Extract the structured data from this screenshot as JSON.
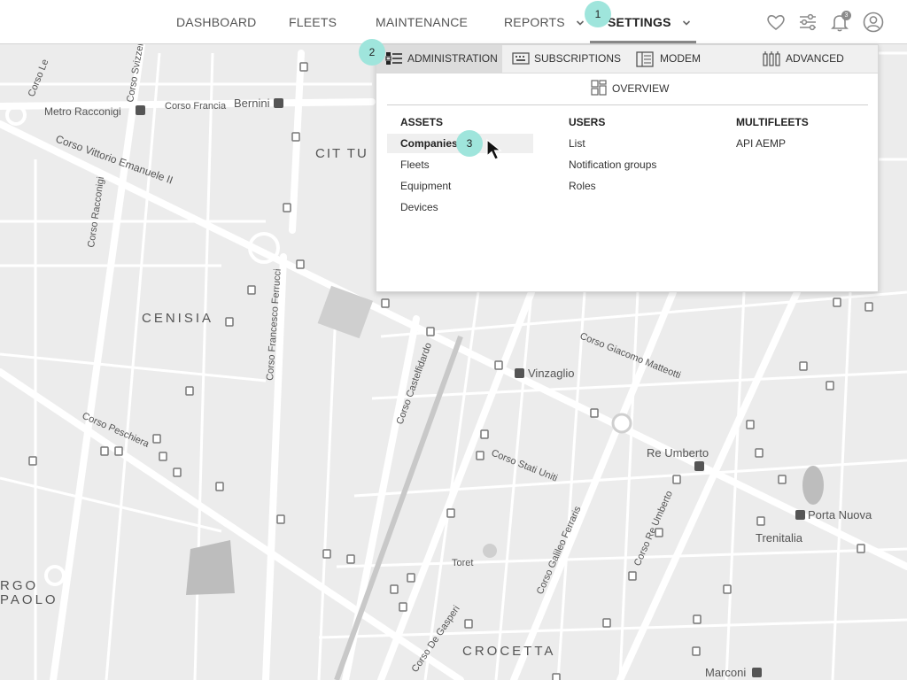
{
  "nav": {
    "items": [
      {
        "label": "DASHBOARD"
      },
      {
        "label": "FLEETS"
      },
      {
        "label": "MAINTENANCE"
      },
      {
        "label": "REPORTS"
      },
      {
        "label": "SETTINGS"
      }
    ],
    "active": "SETTINGS",
    "notification_count": "3",
    "icons": [
      "heart-icon",
      "sliders-icon",
      "bell-icon",
      "user-icon"
    ]
  },
  "markers": [
    "1",
    "2",
    "3"
  ],
  "dropdown": {
    "tabs": [
      {
        "label": "ADMINISTRATION",
        "icon": "list-icon"
      },
      {
        "label": "SUBSCRIPTIONS",
        "icon": "keyboard-icon"
      },
      {
        "label": "MODEM",
        "icon": "modem-icon"
      },
      {
        "label": "ADVANCED",
        "icon": "advanced-icon"
      }
    ],
    "active_tab": "ADMINISTRATION",
    "overview_label": "OVERVIEW",
    "columns": [
      {
        "heading": "ASSETS",
        "items": [
          "Companies",
          "Fleets",
          "Equipment",
          "Devices"
        ]
      },
      {
        "heading": "USERS",
        "items": [
          "List",
          "Notification groups",
          "Roles"
        ]
      },
      {
        "heading": "MULTIFLEETS",
        "items": [
          "API AEMP"
        ]
      }
    ],
    "hovered_item": "Companies"
  },
  "map": {
    "labels": {
      "metro_racconigi": "Metro Racconigi",
      "corso_francia": "Corso Francia",
      "bernini": "Bernini",
      "corso_vittorio": "Corso Vittorio Emanuele II",
      "cit_tu": "CIT TU",
      "cenisia": "CENISIA",
      "corso_ferrucci": "Corso Francesco Ferrucci",
      "corso_racconigi": "Corso Racconigi",
      "corso_peschiera": "Corso Peschiera",
      "corso_castelfidardo": "Corso Castelfidardo",
      "vinzaglio": "Vinzaglio",
      "corso_matteotti": "Corso Giacomo Matteotti",
      "corso_stati_uniti": "Corso Stati Uniti",
      "re_umberto": "Re Umberto",
      "corso_re_umberto": "Corso Re Umberto",
      "corso_galileo_ferraris": "Corso Galileo Ferraris",
      "toret": "Toret",
      "porta_nuova": "Porta Nuova",
      "trenitalia": "Trenitalia",
      "crocetta": "CROCETTA",
      "borgo_san_paolo_1": "RGO",
      "borgo_san_paolo_2": "PAOLO",
      "marconi": "Marconi",
      "corso_de_gasperi": "Corso De Gasperi",
      "corso_svizzera": "Corso Svizzera",
      "corso_le": "Corso Le"
    }
  },
  "colors": {
    "accent_marker": "#9fe5dc",
    "map_background": "#ececec",
    "road": "#ffffff"
  }
}
